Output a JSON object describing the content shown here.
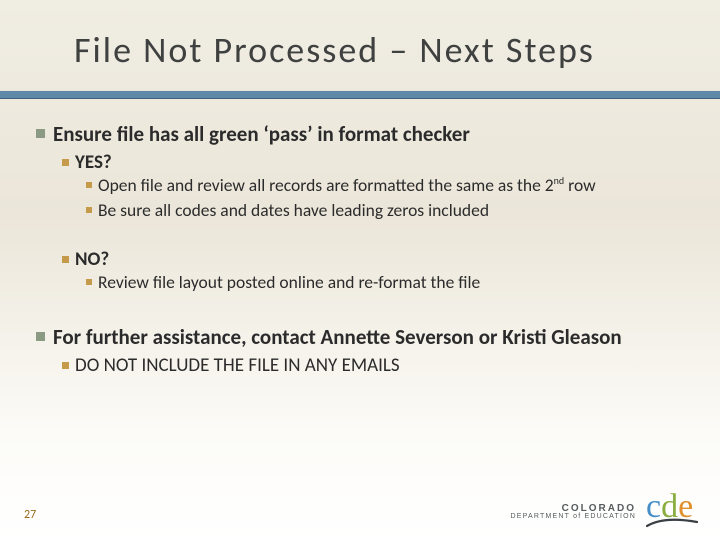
{
  "heading": "File Not Processed – Next Steps",
  "bullets": {
    "l1a": "Ensure file has all green ‘pass’ in format checker",
    "yes": "YES?",
    "yes_sub1_pre": "Open file and review all records are formatted the same as the 2",
    "yes_sub1_sup": "nd",
    "yes_sub1_post": " row",
    "yes_sub2": "Be sure all codes and dates have leading zeros included",
    "no": "NO?",
    "no_sub1": "Review file layout posted online and re-format the file",
    "l1b": "For further assistance, contact Annette Severson or Kristi Gleason",
    "l1b_sub": "DO NOT INCLUDE THE FILE IN ANY EMAILS"
  },
  "footer": {
    "page": "27",
    "org_line1": "COLORADO",
    "org_line2": "DEPARTMENT of EDUCATION",
    "cde_c": "c",
    "cde_d": "d",
    "cde_e": "e"
  }
}
